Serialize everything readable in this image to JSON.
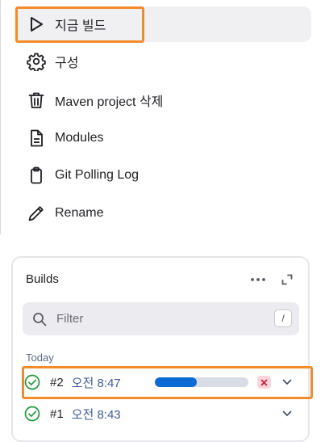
{
  "sidebar": {
    "items": [
      {
        "label": "지금 빌드",
        "icon": "play-icon"
      },
      {
        "label": "구성",
        "icon": "gear-icon"
      },
      {
        "label": "Maven project 삭제",
        "icon": "trash-icon"
      },
      {
        "label": "Modules",
        "icon": "document-icon"
      },
      {
        "label": "Git Polling Log",
        "icon": "clipboard-icon"
      },
      {
        "label": "Rename",
        "icon": "pencil-icon"
      }
    ]
  },
  "builds": {
    "title": "Builds",
    "more_icon": "more-dots-icon",
    "expand_icon": "expand-icon",
    "filter": {
      "placeholder": "Filter",
      "shortcut": "/"
    },
    "group_label": "Today",
    "rows": [
      {
        "number": "#2",
        "time": "오전 8:47",
        "status": "success",
        "in_progress": true,
        "progress": 0.45
      },
      {
        "number": "#1",
        "time": "오전 8:43",
        "status": "success",
        "in_progress": false
      }
    ]
  },
  "colors": {
    "highlight": "#f48b2a",
    "progress": "#0b6ad3",
    "success": "#1e9b3c",
    "cancel_bg": "#fbd5dc",
    "cancel_x": "#d0193a",
    "time_link": "#3d5a9c"
  }
}
